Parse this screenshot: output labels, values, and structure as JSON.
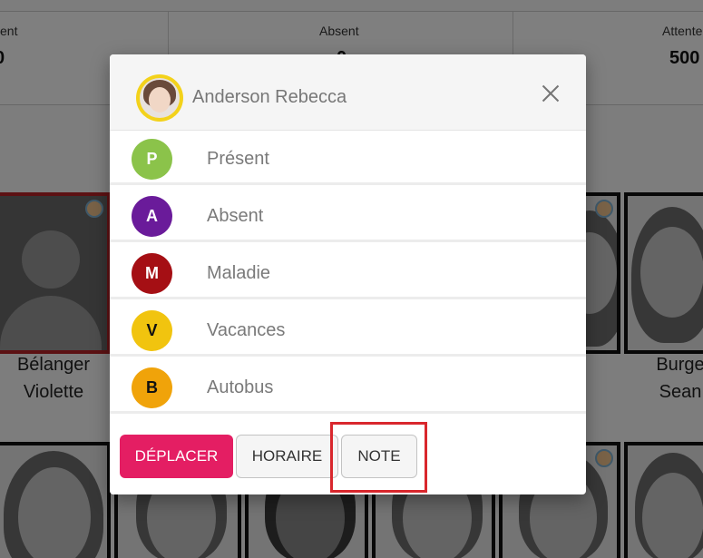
{
  "stats": [
    {
      "label": "ent",
      "value": "0"
    },
    {
      "label": "Absent",
      "value": "0"
    },
    {
      "label": "Attente",
      "value": "500"
    }
  ],
  "background_students": [
    {
      "first": "Bélanger",
      "last": "Violette"
    },
    {
      "first": "Burge",
      "last": "Sean"
    }
  ],
  "modal": {
    "student_name": "Anderson Rebecca",
    "statuses": [
      {
        "letter": "P",
        "label": "Présent",
        "color": "#8bc34a",
        "text_color": "#ffffff"
      },
      {
        "letter": "A",
        "label": "Absent",
        "color": "#6a1b9a",
        "text_color": "#ffffff"
      },
      {
        "letter": "M",
        "label": "Maladie",
        "color": "#a50f14",
        "text_color": "#ffffff"
      },
      {
        "letter": "V",
        "label": "Vacances",
        "color": "#f1c40f",
        "text_color": "#111111"
      },
      {
        "letter": "B",
        "label": "Autobus",
        "color": "#f0a30a",
        "text_color": "#111111"
      }
    ],
    "buttons": {
      "move": "DÉPLACER",
      "schedule": "HORAIRE",
      "note": "NOTE"
    }
  },
  "colors": {
    "primary": "#e41e63",
    "highlight": "#d9272d",
    "avatar_ring": "#f3d21b"
  }
}
